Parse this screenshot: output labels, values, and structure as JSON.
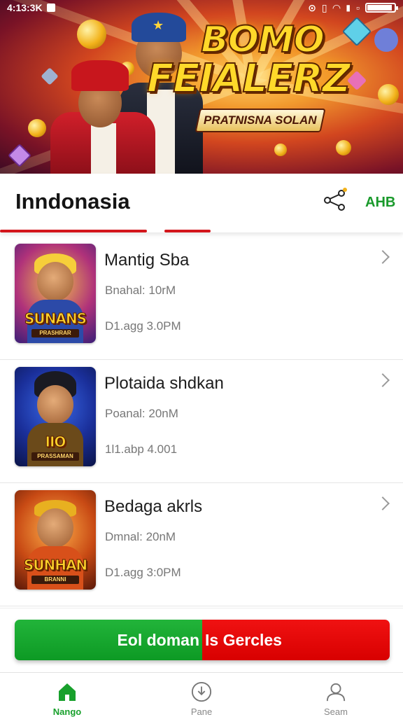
{
  "status_bar": {
    "time": "4:13:3K"
  },
  "banner": {
    "title_line1": "BOMO",
    "title_line2": "FEIALERZ",
    "subtitle": "PRATNISNA SOLAN"
  },
  "header": {
    "title": "Inndonasia",
    "action_label": "AHB",
    "share_icon": "share-icon",
    "accent_color": "#d3161c"
  },
  "games": [
    {
      "name": "Mantig Sba",
      "meta1": "Bnahal: 10rM",
      "meta2": "D1.agg   3.0PM",
      "thumb_title": "SUNANS",
      "thumb_sub": "PRASHRAR",
      "theme": "purple"
    },
    {
      "name": "Plotaida shdkan",
      "meta1": "Poanal: 20nM",
      "meta2": "1l1.abp   4.001",
      "thumb_title": "IIO",
      "thumb_sub": "PRASSAMAN",
      "theme": "blue"
    },
    {
      "name": "Bedaga akrls",
      "meta1": "Dmnal: 20nM",
      "meta2": "D1.agg   3:0PM",
      "thumb_title": "SUNHAN",
      "thumb_sub": "BRANNI",
      "theme": "orange"
    }
  ],
  "cta": {
    "left_label": "Eol doman",
    "right_label": "Is Gercles",
    "left_color": "#13a52c",
    "right_color": "#e80a0a"
  },
  "bottom_nav": {
    "items": [
      {
        "label": "Nango",
        "icon": "home-icon",
        "active": true
      },
      {
        "label": "Pane",
        "icon": "download-icon",
        "active": false
      },
      {
        "label": "Seam",
        "icon": "profile-icon",
        "active": false
      }
    ]
  }
}
